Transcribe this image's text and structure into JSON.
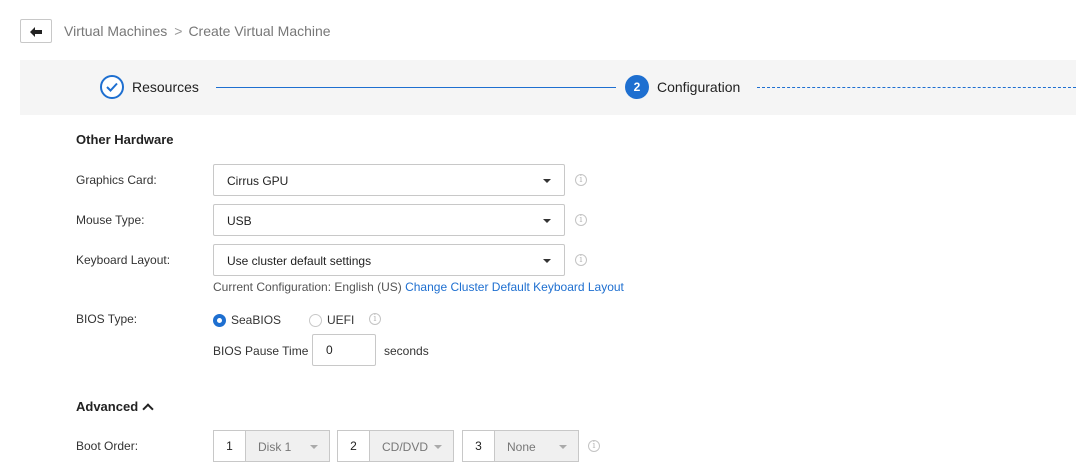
{
  "breadcrumb": {
    "parent": "Virtual Machines",
    "separator": ">",
    "current": "Create Virtual Machine"
  },
  "steps": [
    {
      "label": "Resources",
      "state": "done"
    },
    {
      "number": "2",
      "label": "Configuration",
      "state": "active"
    }
  ],
  "other_hardware": {
    "title": "Other Hardware",
    "graphics_card": {
      "label": "Graphics Card:",
      "value": "Cirrus GPU"
    },
    "mouse_type": {
      "label": "Mouse Type:",
      "value": "USB"
    },
    "keyboard_layout": {
      "label": "Keyboard Layout:",
      "value": "Use cluster default settings"
    },
    "keyboard_hint": {
      "text": "Current Configuration: English (US)",
      "link": "Change Cluster Default Keyboard Layout"
    },
    "bios_type": {
      "label": "BIOS Type:",
      "options": [
        "SeaBIOS",
        "UEFI"
      ],
      "selected": "SeaBIOS"
    },
    "bios_pause": {
      "label": "BIOS Pause Time",
      "value": "0",
      "unit": "seconds"
    }
  },
  "advanced": {
    "title": "Advanced",
    "boot_order": {
      "label": "Boot Order:",
      "items": [
        {
          "num": "1",
          "value": "Disk 1"
        },
        {
          "num": "2",
          "value": "CD/DVD"
        },
        {
          "num": "3",
          "value": "None"
        }
      ]
    }
  },
  "colors": {
    "accent": "#1e6fd0",
    "step_bar_bg": "#f5f5f5",
    "disabled_bg": "#f0f0f0"
  },
  "icons": [
    "back-arrow-icon",
    "check-icon",
    "caret-down-icon",
    "info-icon",
    "chevron-up-icon"
  ]
}
